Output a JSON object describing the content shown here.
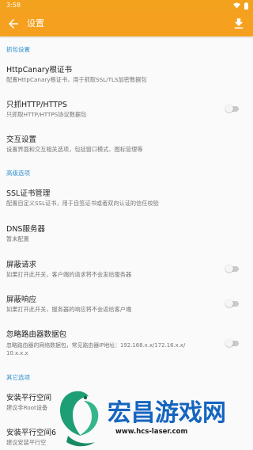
{
  "status_bar": {
    "time": "3:58"
  },
  "app_bar": {
    "title": "设置"
  },
  "sections": {
    "capture": "抓包设置",
    "advanced": "高级选项",
    "other": "其它选项"
  },
  "items": {
    "cert": {
      "title": "HttpCanary根证书",
      "summary": "配置HttpCanary根证书，用于抓取SSL/TLS加密数据包"
    },
    "http_only": {
      "title": "只抓HTTP/HTTPS",
      "summary": "只抓取HTTP/HTTPS协议数据包",
      "enabled": false
    },
    "interaction": {
      "title": "交互设置",
      "summary": "设置界面和交互相关选项，包括窗口模式、图标管理等"
    },
    "ssl": {
      "title": "SSL证书管理",
      "summary": "配置自定义SSL证书，用于自签证书或者双向认证的信任校验"
    },
    "dns": {
      "title": "DNS服务器",
      "summary": "暂未配置"
    },
    "block_request": {
      "title": "屏蔽请求",
      "summary": "如果打开此开关，客户端的请求将不会发给服务器",
      "enabled": false
    },
    "block_response": {
      "title": "屏蔽响应",
      "summary": "如果打开此开关，服务器的响应将不会返给客户端",
      "enabled": false
    },
    "ignore_router": {
      "title": "忽略路由器数据包",
      "summary_line1": "忽略路由器的网络数据包，常见路由器IP地址：192.168.x.x/172.16.x.x/",
      "summary_line2": "10.x.x.x",
      "enabled": false
    },
    "parallel1": {
      "title": "安装平行空间",
      "summary": "建议非Root设备"
    },
    "parallel2": {
      "title": "安装平行空间6",
      "summary": "建议安装平行空"
    }
  },
  "watermark": {
    "text": "宏昌游戏网",
    "url": "www.hcs-laser.com"
  },
  "colors": {
    "accent": "#f5a11f",
    "section": "#2c8ecf",
    "watermark": "#1565c0"
  }
}
